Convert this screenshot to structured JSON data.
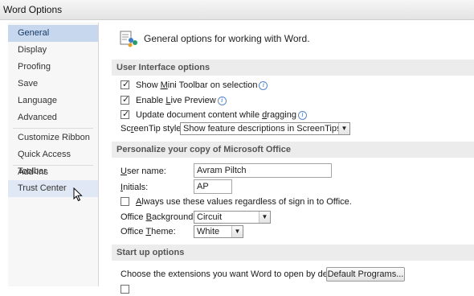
{
  "window": {
    "title": "Word Options"
  },
  "sidebar": {
    "items": [
      {
        "label": "General"
      },
      {
        "label": "Display"
      },
      {
        "label": "Proofing"
      },
      {
        "label": "Save"
      },
      {
        "label": "Language"
      },
      {
        "label": "Advanced"
      },
      {
        "label": "Customize Ribbon"
      },
      {
        "label": "Quick Access Toolbar"
      },
      {
        "label": "Add-Ins"
      },
      {
        "label": "Trust Center"
      }
    ],
    "active": "General",
    "hovered": "Trust Center"
  },
  "header": {
    "text": "General options for working with Word."
  },
  "ui_options": {
    "heading": "User Interface options",
    "mini_toolbar": {
      "pre": "Show ",
      "u": "M",
      "post": "ini Toolbar on selection",
      "checked": true
    },
    "live_preview": {
      "pre": "Enable ",
      "u": "L",
      "post": "ive Preview",
      "checked": true
    },
    "update_drag": {
      "pre": "Update document content while ",
      "u": "d",
      "post": "ragging",
      "checked": true
    },
    "screentip": {
      "pre": "Sc",
      "u": "r",
      "post": "eenTip style:",
      "value": "Show feature descriptions in ScreenTips"
    }
  },
  "personalize": {
    "heading": "Personalize your copy of Microsoft Office",
    "username": {
      "u": "U",
      "post": "ser name:",
      "value": "Avram Piltch"
    },
    "initials": {
      "u": "I",
      "post": "nitials:",
      "value": "AP"
    },
    "always_use": {
      "u": "A",
      "post": "lways use these values regardless of sign in to Office.",
      "checked": false
    },
    "background": {
      "pre": "Office ",
      "u": "B",
      "post": "ackground:",
      "value": "Circuit"
    },
    "theme": {
      "pre": "Office ",
      "u": "T",
      "post": "heme:",
      "value": "White"
    }
  },
  "startup": {
    "heading": "Start up options",
    "extensions_label": "Choose the extensions you want Word to open by default:",
    "default_programs_button": "Default Programs..."
  },
  "icons": {
    "info": "info-icon",
    "check": "checkmark-icon",
    "dropdown": "chevron-down-icon",
    "header": "general-options-icon",
    "cursor": "mouse-pointer-icon"
  },
  "colors": {
    "active_nav": "#c7d7ee",
    "section_bg": "#ececec",
    "info_blue": "#2f67b3"
  }
}
